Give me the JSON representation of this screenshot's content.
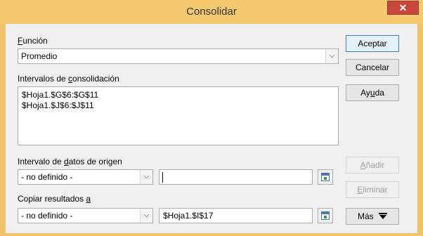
{
  "window": {
    "title": "Consolidar",
    "close_glyph": "✕"
  },
  "funcion": {
    "label": "Función",
    "accel": "F",
    "label_rest": "unción",
    "value": "Promedio"
  },
  "intervalos": {
    "label": "Intervalos de consolidación",
    "label_pre": "Intervalos de ",
    "accel": "c",
    "label_post": "onsolidación",
    "items": [
      "$Hoja1.$G$6:$G$11",
      "$Hoja1.$J$6:$J$11"
    ]
  },
  "origen": {
    "label": "Intervalo de datos de origen",
    "label_pre": "Intervalo de ",
    "accel": "d",
    "label_post": "atos de origen",
    "combo_value": "- no definido -",
    "text_value": ""
  },
  "copiar": {
    "label": "Copiar resultados a",
    "label_pre": "Copiar resultados ",
    "accel": "a",
    "combo_value": "- no definido -",
    "text_value": "$Hoja1.$I$17"
  },
  "buttons": {
    "aceptar": "Aceptar",
    "cancelar": "Cancelar",
    "ayuda_pre": "Ay",
    "ayuda_accel": "u",
    "ayuda_post": "da",
    "anadir_accel": "A",
    "anadir_post": "ñadir",
    "eliminar_accel": "E",
    "eliminar_post": "liminar",
    "mas": "Más"
  },
  "icons": {
    "dropdown": "chevron-down-icon",
    "shrink": "shrink-dialog-icon",
    "more": "double-chevron-down-icon"
  }
}
